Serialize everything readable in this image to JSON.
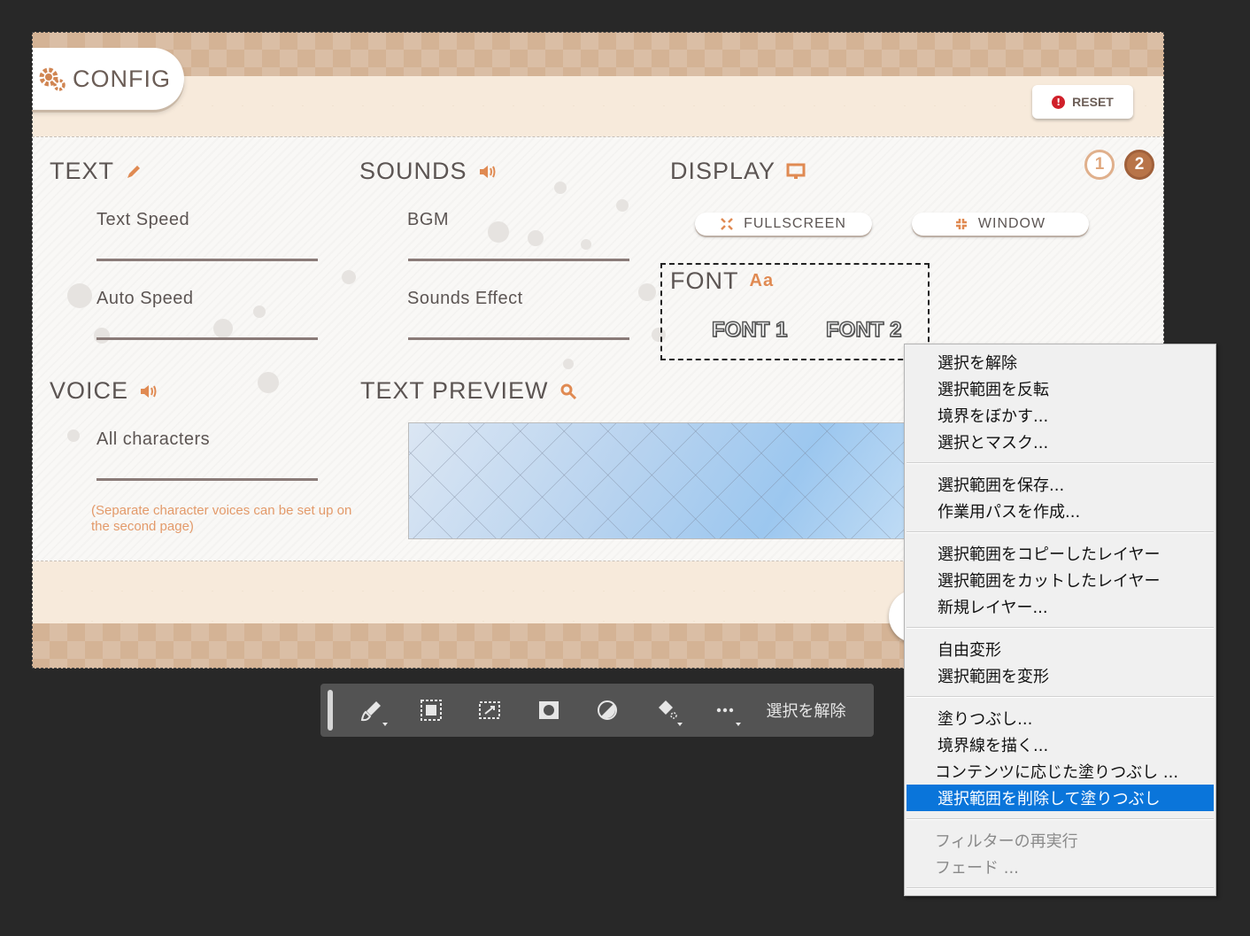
{
  "game_ui": {
    "config_title": "CONFIG",
    "reset_label": "RESET",
    "pages": [
      "1",
      "2"
    ],
    "sections": {
      "text": {
        "title": "TEXT",
        "items": [
          "Text Speed",
          "Auto Speed"
        ]
      },
      "sounds": {
        "title": "SOUNDS",
        "items": [
          "BGM",
          "Sounds Effect"
        ]
      },
      "display": {
        "title": "DISPLAY",
        "fullscreen": "FULLSCREEN",
        "window": "WINDOW"
      },
      "font": {
        "title": "FONT",
        "icon_text": "Aa",
        "options": [
          "FONT 1",
          "FONT 2"
        ]
      },
      "voice": {
        "title": "VOICE",
        "items": [
          "All characters"
        ],
        "note": "(Separate character voices can be set up on the second page)"
      },
      "preview": {
        "title": "TEXT PREVIEW"
      }
    },
    "accent_color": "#e08a52"
  },
  "taskbar": {
    "icons": [
      "brush-icon",
      "select-subject-icon",
      "transform-selection-icon",
      "mask-icon",
      "adjustment-icon",
      "fill-icon",
      "more-icon"
    ],
    "deselect_label": "選択を解除"
  },
  "context_menu": {
    "groups": [
      [
        "選択を解除",
        "選択範囲を反転",
        "境界をぼかす...",
        "選択とマスク..."
      ],
      [
        "選択範囲を保存...",
        "作業用パスを作成..."
      ],
      [
        "選択範囲をコピーしたレイヤー",
        "選択範囲をカットしたレイヤー",
        "新規レイヤー..."
      ],
      [
        "自由変形",
        "選択範囲を変形"
      ],
      [
        "塗りつぶし...",
        "境界線を描く...",
        "コンテンツに応じた塗りつぶし ...",
        "選択範囲を削除して塗りつぶし"
      ],
      [
        "フィルターの再実行",
        "フェード ..."
      ]
    ],
    "highlighted": "選択範囲を削除して塗りつぶし",
    "highlight_color": "#0a75da"
  }
}
